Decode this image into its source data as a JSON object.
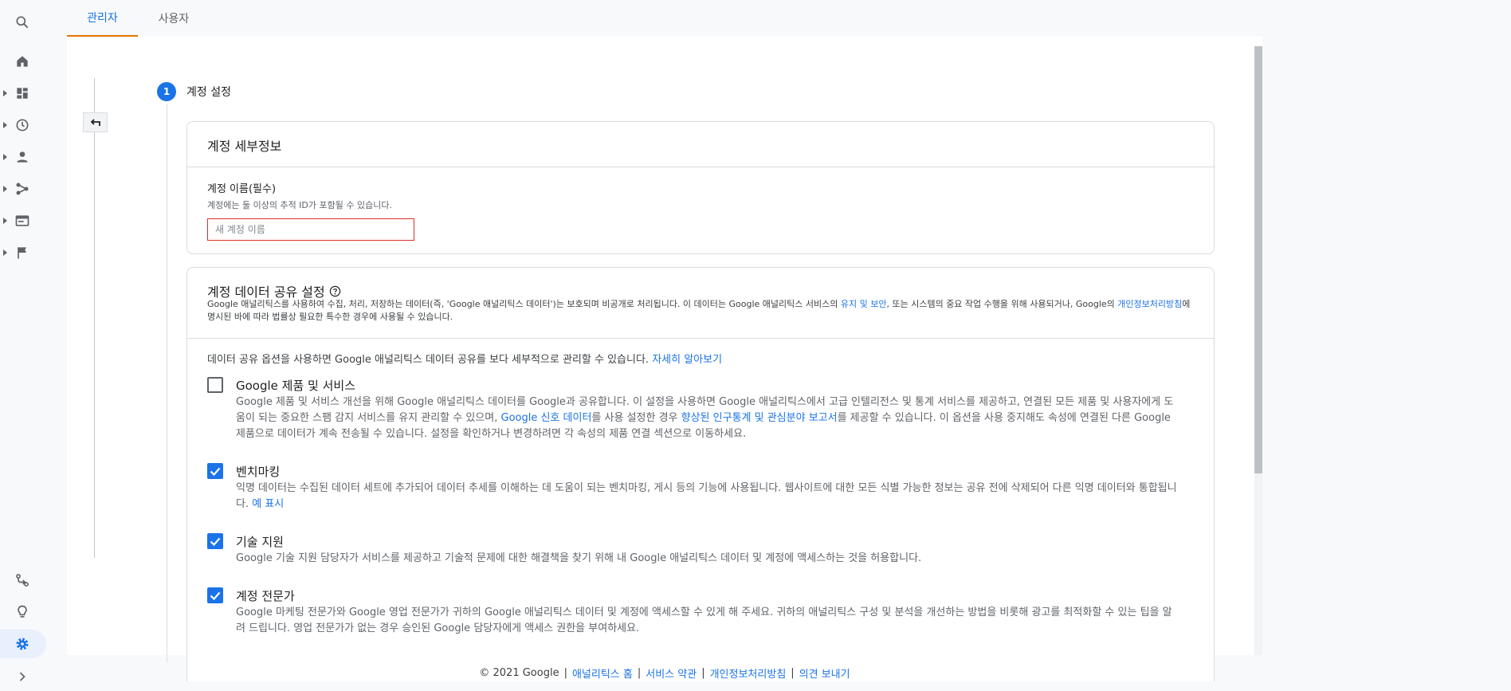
{
  "tabs": [
    {
      "label": "관리자",
      "active": true
    },
    {
      "label": "사용자",
      "active": false
    }
  ],
  "leftnav": {
    "icons": [
      "search-icon",
      "home-icon",
      "dashboard-icon",
      "realtime-clock-icon",
      "audience-person-icon",
      "acquisition-icon",
      "behavior-icon",
      "conversions-flag-icon",
      "attribution-icon",
      "discover-lightbulb-icon",
      "admin-gear-icon",
      "expand-chevron-icon"
    ]
  },
  "stepper": {
    "step_number": "1",
    "step_title": "계정 설정"
  },
  "account_details": {
    "title": "계정 세부정보",
    "name_label": "계정 이름(필수)",
    "name_help": "계정에는 둘 이상의 추적 ID가 포함될 수 있습니다.",
    "name_placeholder": "새 계정 이름",
    "name_value": ""
  },
  "sharing": {
    "title": "계정 데이터 공유 설정",
    "desc_part1": "Google 애널리틱스를 사용하여 수집, 처리, 저장하는 데이터(즉, 'Google 애널리틱스 데이터')는 보호되며 비공개로 처리됩니다. 이 데이터는 Google 애널리틱스 서비스의 ",
    "desc_link1": "유지 및 보안",
    "desc_part2": ", 또는 시스템의 중요 작업 수행을 위해 사용되거나, Google의 ",
    "desc_link2": "개인정보처리방침",
    "desc_part3": "에 명시된 바에 따라 법률상 필요한 특수한 경우에 사용될 수 있습니다.",
    "intro_text": "데이터 공유 옵션을 사용하면 Google 애널리틱스 데이터 공유를 보다 세부적으로 관리할 수 있습니다. ",
    "intro_link": "자세히 알아보기",
    "options": [
      {
        "title": "Google 제품 및 서비스",
        "checked": false,
        "desc_part1": "Google 제품 및 서비스 개선을 위해 Google 애널리틱스 데이터를 Google과 공유합니다. 이 설정을 사용하면 Google 애널리틱스에서 고급 인텔리전스 및 통계 서비스를 제공하고, 연결된 모든 제품 및 사용자에게 도움이 되는 중요한 스팸 감지 서비스를 유지 관리할 수 있으며, ",
        "desc_link1": "Google 신호 데이터",
        "desc_part2": "를 사용 설정한 경우 ",
        "desc_link2": "향상된 인구통계 및 관심분야 보고서",
        "desc_part3": "를 제공할 수 있습니다. 이 옵션을 사용 중지해도 속성에 연결된 다른 Google 제품으로 데이터가 계속 전송될 수 있습니다. 설정을 확인하거나 변경하려면 각 속성의 제품 연결 섹션으로 이동하세요."
      },
      {
        "title": "벤치마킹",
        "checked": true,
        "desc_part1": "익명 데이터는 수집된 데이터 세트에 추가되어 데이터 추세를 이해하는 데 도움이 되는 벤치마킹, 게시 등의 기능에 사용됩니다. 웹사이트에 대한 모든 식별 가능한 정보는 공유 전에 삭제되어 다른 익명 데이터와 통합됩니다.  ",
        "desc_link1": "예 표시"
      },
      {
        "title": "기술 지원",
        "checked": true,
        "desc_part1": "Google 기술 지원 담당자가 서비스를 제공하고 기술적 문제에 대한 해결책을 찾기 위해 내 Google 애널리틱스 데이터 및 계정에 액세스하는 것을 허용합니다."
      },
      {
        "title": "계정 전문가",
        "checked": true,
        "desc_part1": "Google 마케팅 전문가와 Google 영업 전문가가 귀하의 Google 애널리틱스 데이터 및 계정에 액세스할 수 있게 해 주세요. 귀하의 애널리틱스 구성 및 분석을 개선하는 방법을 비롯해 광고를 최적화할 수 있는 팁을 알려 드립니다. 영업 전문가가 없는 경우 승인된 Google 담당자에게 액세스 권한을 부여하세요."
      }
    ]
  },
  "footer": {
    "copyright": "© 2021 Google",
    "link_home": "애널리틱스 홈",
    "link_terms": "서비스 약관",
    "link_privacy": "개인정보처리방침",
    "link_feedback": "의견 보내기"
  },
  "colors": {
    "accent": "#1a73e8",
    "tab_indicator": "#e37400",
    "error": "#d93025"
  }
}
